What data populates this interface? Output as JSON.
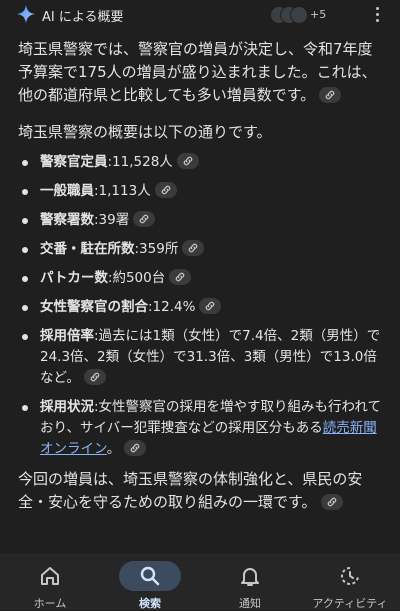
{
  "header": {
    "title": "AI による概要",
    "plus_count": "+5"
  },
  "intro": "埼玉県警察では、警察官の増員が決定し、令和7年度予算案で175人の増員が盛り込まれました。これは、他の都道府県と比較しても多い増員数です。",
  "overview_lead": "埼玉県警察の概要は以下の通りです。",
  "facts": [
    {
      "label": "警察官定員",
      "value": ":11,528人"
    },
    {
      "label": "一般職員",
      "value": ":1,113人"
    },
    {
      "label": "警察署数",
      "value": ":39署"
    },
    {
      "label": "交番・駐在所数",
      "value": ":359所"
    },
    {
      "label": "パトカー数",
      "value": ":約500台"
    },
    {
      "label": "女性警察官の割合",
      "value": ":12.4%"
    },
    {
      "label": "採用倍率",
      "value": ":過去には1類（女性）で7.4倍、2類（男性）で24.3倍、2類（女性）で31.3倍、3類（男性）で13.0倍など。"
    },
    {
      "label": "採用状況",
      "value": ":女性警察官の採用を増やす取り組みも行われており、サイバー犯罪捜査などの採用区分もある",
      "source": "読売新聞オンライン",
      "tail": "。"
    }
  ],
  "conclusion": "今回の増員は、埼玉県警察の体制強化と、県民の安全・安心を守るための取り組みの一環です。",
  "nav": [
    {
      "label": "ホーム",
      "icon": "home-icon",
      "active": false
    },
    {
      "label": "検索",
      "icon": "search-icon",
      "active": true
    },
    {
      "label": "通知",
      "icon": "bell-icon",
      "active": false
    },
    {
      "label": "アクティビティ",
      "icon": "activity-icon",
      "active": false
    }
  ],
  "colors": {
    "background": "#1f1f1f",
    "link": "#8ab4f8",
    "active_pill": "#3d4b5f"
  }
}
